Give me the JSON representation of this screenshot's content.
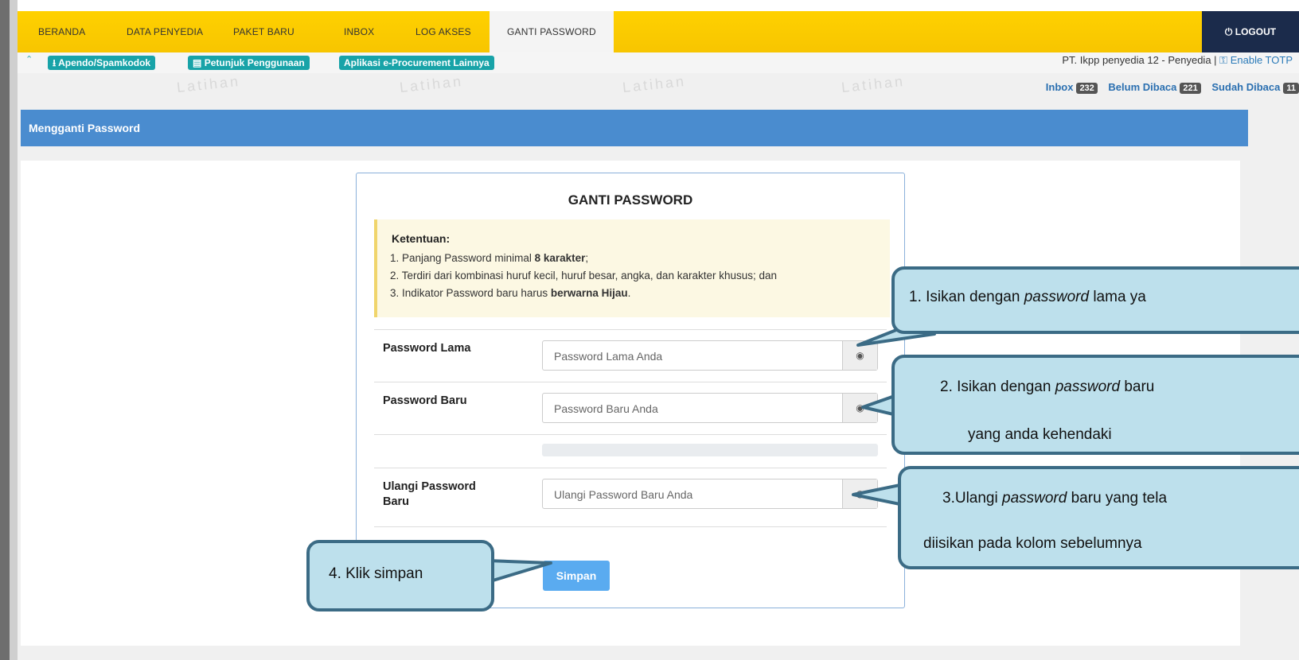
{
  "nav": {
    "items": [
      "BERANDA",
      "DATA PENYEDIA",
      "PAKET BARU",
      "INBOX",
      "LOG AKSES",
      "GANTI PASSWORD"
    ],
    "active": "GANTI PASSWORD",
    "logout_label": "LOGOUT"
  },
  "subbar": {
    "links": [
      "Apendo/Spamkodok",
      "Petunjuk Penggunaan",
      "Aplikasi e-Procurement Lainnya"
    ],
    "user_info": "PT. Ikpp penyedia 12 - Penyedia |",
    "totp_label": "Enable TOTP",
    "watermark": "Latihan"
  },
  "inbox": {
    "inbox_label": "Inbox",
    "inbox_count": "232",
    "unread_label": "Belum Dibaca",
    "unread_count": "221",
    "read_label": "Sudah Dibaca",
    "read_count": "11"
  },
  "panel_title": "Mengganti Password",
  "form": {
    "title": "GANTI PASSWORD",
    "rules_title": "Ketentuan:",
    "rule1_pre": "1. Panjang Password minimal ",
    "rule1_bold": "8 karakter",
    "rule1_post": ";",
    "rule2": "2. Terdiri dari kombinasi huruf kecil, huruf besar, angka, dan karakter khusus; dan",
    "rule3_pre": "3. Indikator Password baru harus ",
    "rule3_bold": "berwarna Hijau",
    "rule3_post": ".",
    "old_label": "Password Lama",
    "old_placeholder": "Password Lama Anda",
    "new_label": "Password Baru",
    "new_placeholder": "Password Baru Anda",
    "repeat_label_1": "Ulangi Password",
    "repeat_label_2": "Baru",
    "repeat_placeholder": "Ulangi Password Baru Anda",
    "save_label": "Simpan",
    "strength_percent": 0
  },
  "callouts": {
    "c1_pre": "1. Isikan dengan ",
    "c1_em": "password",
    "c1_post": " lama ya",
    "c2_pre": "2. Isikan dengan ",
    "c2_em": "password",
    "c2_post": " baru",
    "c2_line2": "yang anda kehendaki",
    "c3_pre": "3.Ulangi ",
    "c3_em": "password",
    "c3_post": " baru yang tela",
    "c3_line2": "diisikan pada kolom sebelumnya",
    "c4": "4. Klik simpan"
  },
  "colors": {
    "navbar": "#ffd100",
    "logout_bg": "#1b2b4b",
    "panel_header": "#4a8ccf",
    "pill": "#18a3a8",
    "callout_fill": "#bde0ec",
    "callout_border": "#3b6b85",
    "save_button": "#5aabf0"
  }
}
